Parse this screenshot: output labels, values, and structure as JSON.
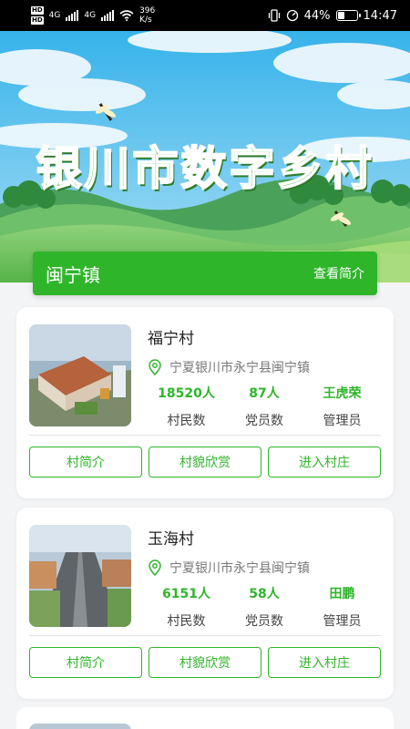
{
  "status_bar": {
    "hd_top": "HD",
    "hd_bottom": "HD",
    "signal_a": "4G",
    "signal_b": "4G",
    "net_speed": "396",
    "net_unit": "K/s",
    "battery_percent": "44%",
    "battery_level": 0.44,
    "time": "14:47"
  },
  "hero": {
    "title": "银川市数字乡村"
  },
  "town": {
    "name": "闽宁镇",
    "intro_link": "查看简介"
  },
  "villages": [
    {
      "name": "福宁村",
      "address": "宁夏银川市永宁县闽宁镇",
      "stats": [
        {
          "value": "18520人",
          "label": "村民数"
        },
        {
          "value": "87人",
          "label": "党员数"
        },
        {
          "value": "王虎荣",
          "label": "管理员"
        }
      ],
      "buttons": [
        "村简介",
        "村貌欣赏",
        "进入村庄"
      ]
    },
    {
      "name": "玉海村",
      "address": "宁夏银川市永宁县闽宁镇",
      "stats": [
        {
          "value": "6151人",
          "label": "村民数"
        },
        {
          "value": "58人",
          "label": "党员数"
        },
        {
          "value": "田鹏",
          "label": "管理员"
        }
      ],
      "buttons": [
        "村简介",
        "村貌欣赏",
        "进入村庄"
      ]
    }
  ]
}
